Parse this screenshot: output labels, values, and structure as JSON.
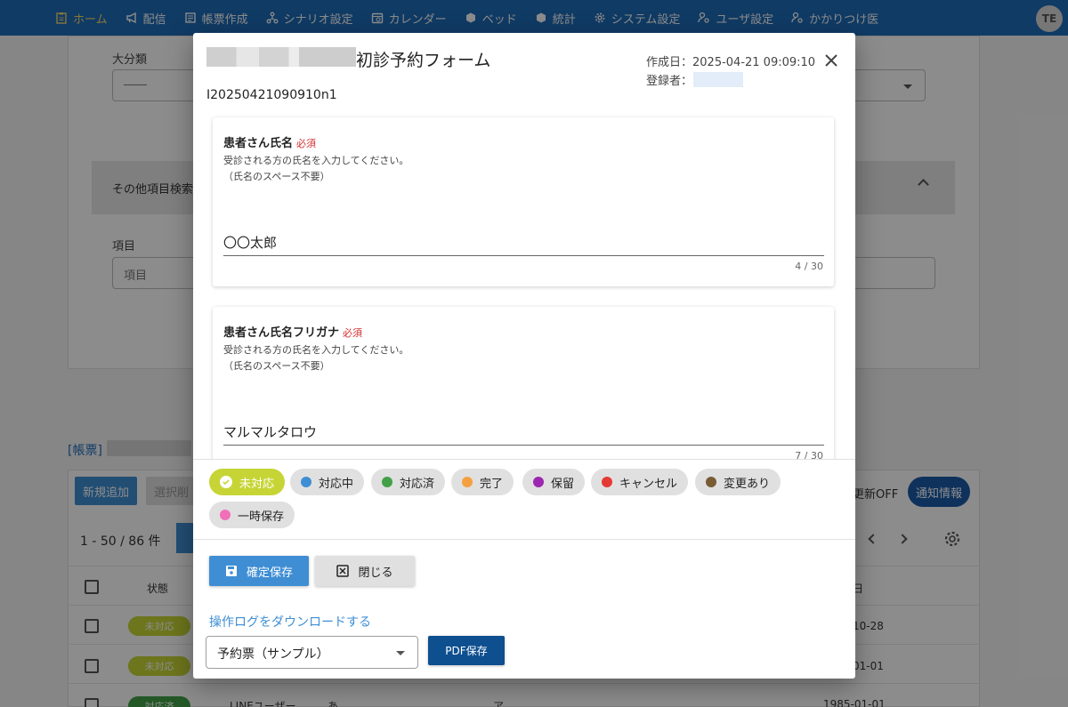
{
  "nav": {
    "items": [
      {
        "label": "ホーム",
        "icon": "clipboard-icon",
        "active": true
      },
      {
        "label": "配信",
        "icon": "megaphone-icon"
      },
      {
        "label": "帳票作成",
        "icon": "form-icon"
      },
      {
        "label": "シナリオ設定",
        "icon": "tree-icon"
      },
      {
        "label": "カレンダー",
        "icon": "calendar-icon"
      },
      {
        "label": "ベッド",
        "icon": "cube-icon"
      },
      {
        "label": "統計",
        "icon": "cube-icon"
      },
      {
        "label": "システム設定",
        "icon": "gear-icon"
      },
      {
        "label": "ユーザ設定",
        "icon": "user-gear-icon"
      },
      {
        "label": "かかりつけ医",
        "icon": "user-gear-icon"
      }
    ],
    "avatar": "TE"
  },
  "background": {
    "major_category_label": "大分類",
    "major_category_value": "――",
    "other_search_label": "その他項目検索",
    "item_label": "項目",
    "item_placeholder": "項目",
    "forms_link": "[帳票]",
    "new_button": "新規追加",
    "select_button": "選択削",
    "auto_update": "更新OFF",
    "notify_button": "通知情報",
    "pagination": "1 - 50 / 86 件",
    "col_status": "状態",
    "col_date": "日",
    "rows": [
      {
        "status": "未対応",
        "date": "10-28"
      },
      {
        "status": "未対応",
        "date": "01-01"
      },
      {
        "status": "対応済",
        "user": "LINEユーザー",
        "a": "あ",
        "b": "ア",
        "date": "1985-01-01"
      }
    ]
  },
  "modal": {
    "title": "初診予約フォーム",
    "created": "作成日：2025-04-21 09:09:10",
    "registrant": "登録者：",
    "record_id": "I20250421090910n1",
    "fields": [
      {
        "title": "患者さん氏名",
        "required": "必須",
        "desc1": "受診される方の氏名を入力してください。",
        "desc2": "（氏名のスペース不要）",
        "value": "〇〇太郎",
        "count": "4 / 30"
      },
      {
        "title": "患者さん氏名フリガナ",
        "required": "必須",
        "desc1": "受診される方の氏名を入力してください。",
        "desc2": "（氏名のスペース不要）",
        "value": "マルマルタロウ",
        "count": "7 / 30"
      }
    ],
    "statuses": [
      {
        "label": "未対応",
        "color": "#c6d535",
        "selected": true
      },
      {
        "label": "対応中",
        "color": "#3f8ed4"
      },
      {
        "label": "対応済",
        "color": "#43a047"
      },
      {
        "label": "完了",
        "color": "#f5a040"
      },
      {
        "label": "保留",
        "color": "#9c27b0"
      },
      {
        "label": "キャンセル",
        "color": "#e53935"
      },
      {
        "label": "変更あり",
        "color": "#795c34"
      },
      {
        "label": "一時保存",
        "color": "#f06fb8"
      }
    ],
    "save_button": "確定保存",
    "close_button": "閉じる",
    "download_log": "操作ログをダウンロードする",
    "template_select": "予約票（サンプル）",
    "pdf_button": "PDF保存"
  }
}
